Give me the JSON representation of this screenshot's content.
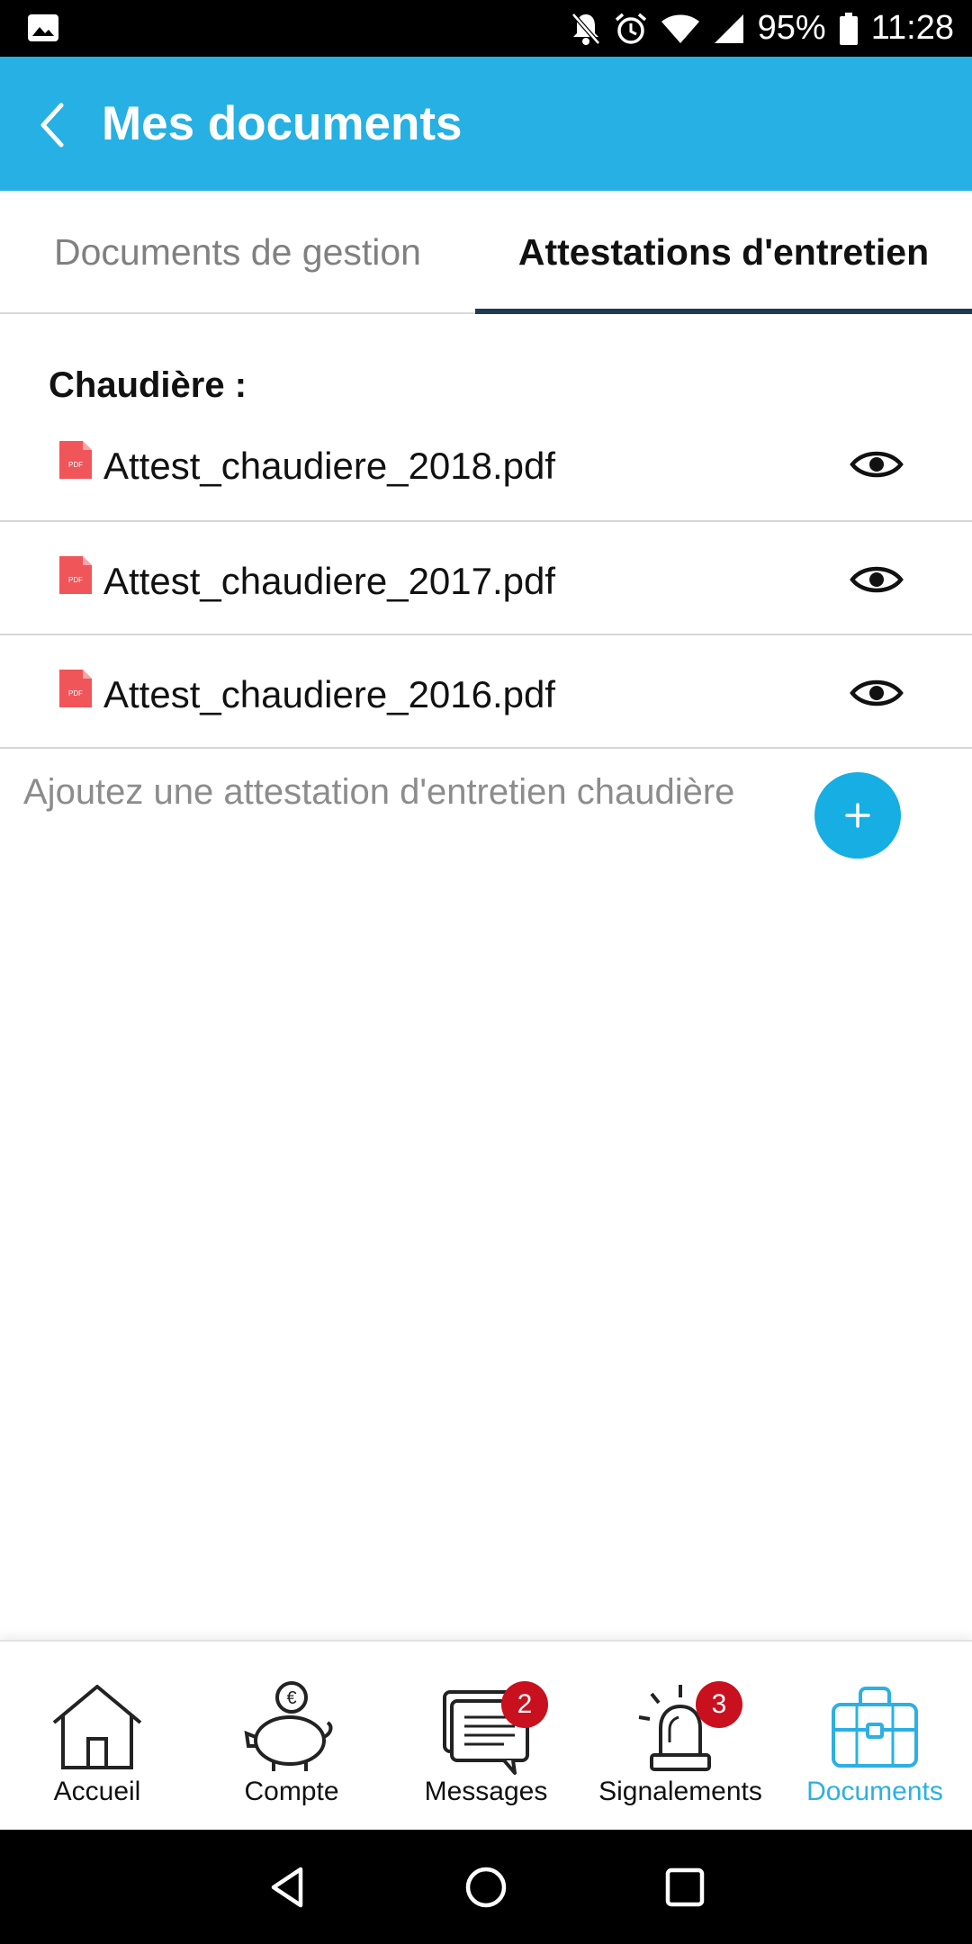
{
  "status_bar": {
    "battery": "95%",
    "time": "11:28",
    "icons": [
      "image-icon",
      "bell-off-icon",
      "alarm-icon",
      "wifi-icon",
      "signal-icon",
      "battery-icon"
    ]
  },
  "app_bar": {
    "title": "Mes documents",
    "back_icon": "chevron-left-icon",
    "background_color": "#27b0e3"
  },
  "tabs": [
    {
      "label": "Documents de gestion",
      "selected": false
    },
    {
      "label": "Attestations d'entretien",
      "selected": true
    }
  ],
  "section": {
    "title": "Chaudière :",
    "files": [
      {
        "name": "Attest_chaudiere_2018.pdf",
        "icon": "pdf-file-icon",
        "action_icon": "eye-icon"
      },
      {
        "name": "Attest_chaudiere_2017.pdf",
        "icon": "pdf-file-icon",
        "action_icon": "eye-icon"
      },
      {
        "name": "Attest_chaudiere_2016.pdf",
        "icon": "pdf-file-icon",
        "action_icon": "eye-icon"
      }
    ],
    "add_text": "Ajoutez une attestation d'entretien chaudière",
    "add_button_icon": "plus-icon"
  },
  "bottom_nav": [
    {
      "label": "Accueil",
      "icon": "house-icon",
      "badge": null,
      "active": false
    },
    {
      "label": "Compte",
      "icon": "piggy-bank-icon",
      "badge": null,
      "active": false
    },
    {
      "label": "Messages",
      "icon": "message-icon",
      "badge": "2",
      "active": false
    },
    {
      "label": "Signalements",
      "icon": "alarm-light-icon",
      "badge": "3",
      "active": false
    },
    {
      "label": "Documents",
      "icon": "briefcase-icon",
      "badge": null,
      "active": true
    }
  ],
  "colors": {
    "accent": "#27b0e3",
    "tab_indicator": "#1d3a52",
    "badge": "#c8101e",
    "pdf": "#f0555a"
  }
}
